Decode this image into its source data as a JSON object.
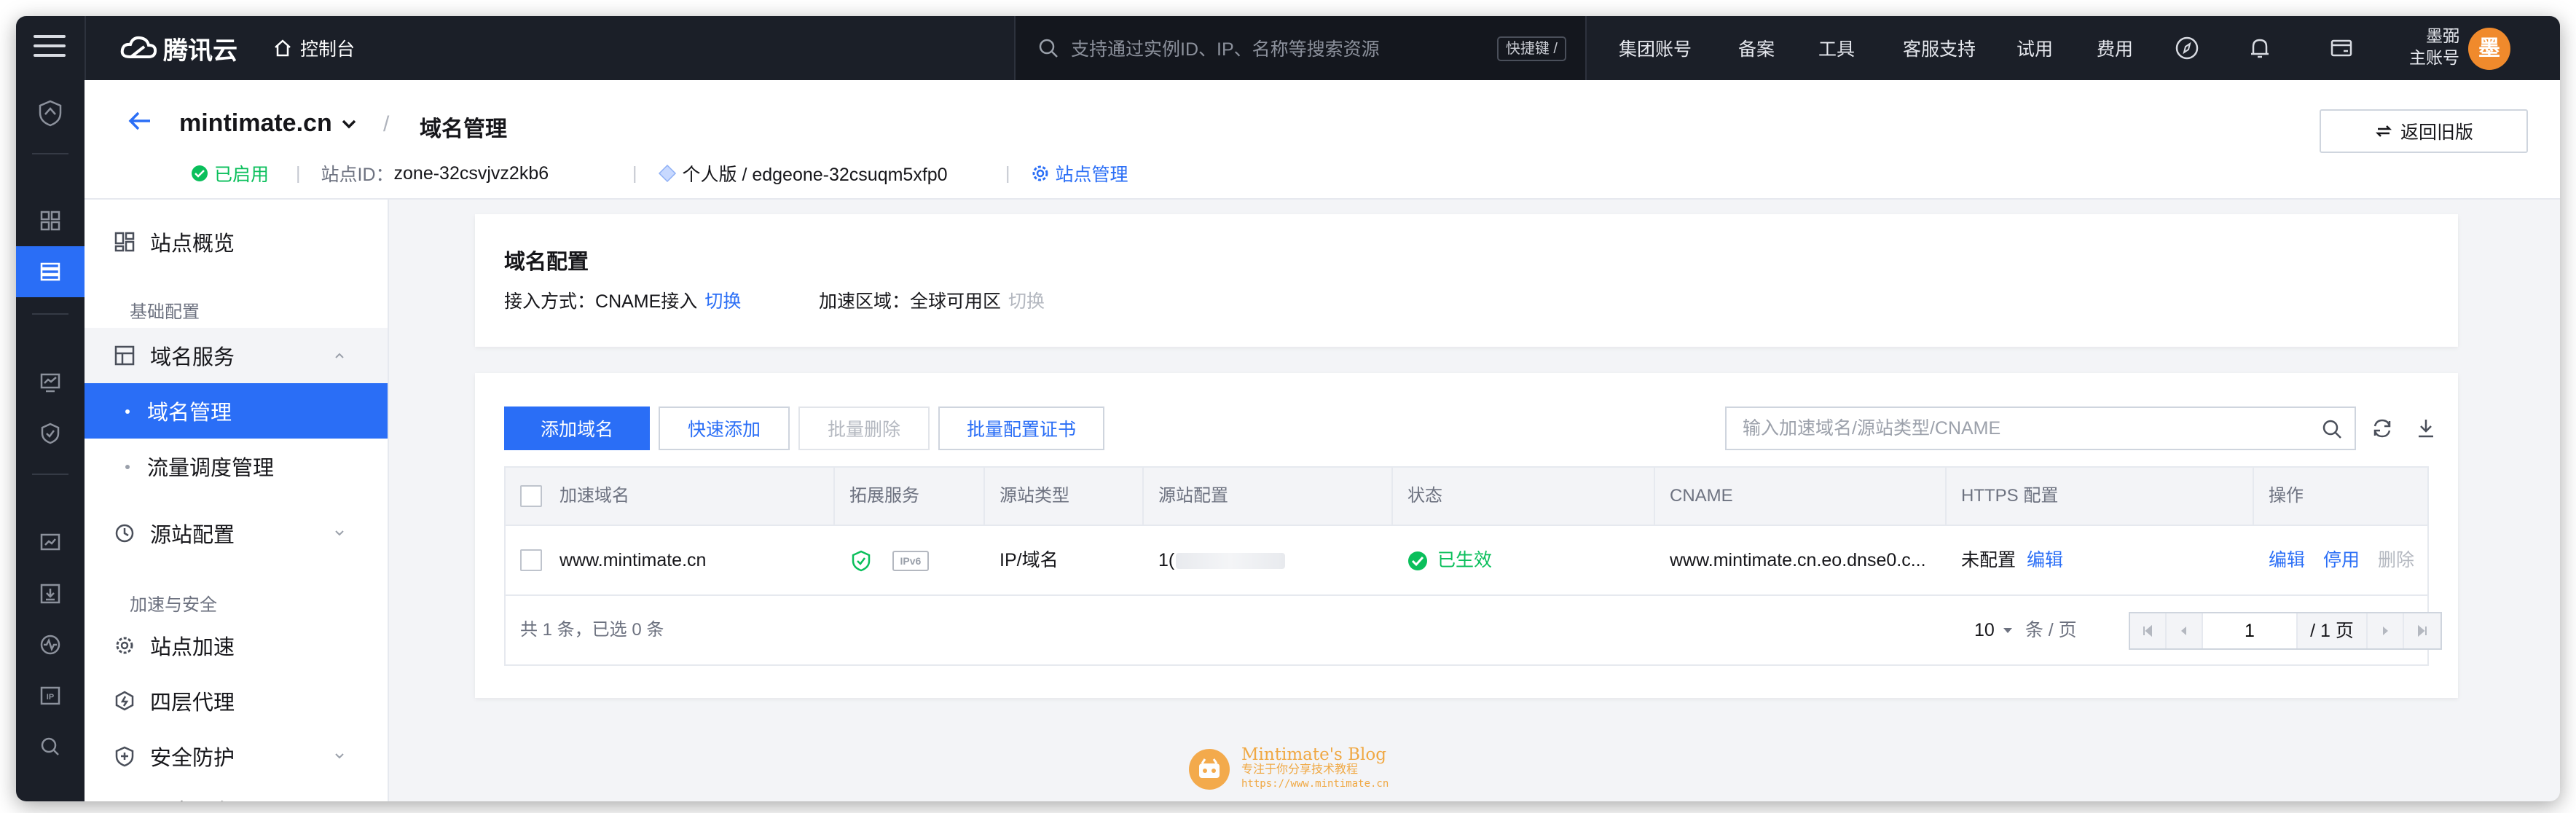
{
  "topbar": {
    "logo_text": "腾讯云",
    "console_label": "控制台",
    "search_placeholder": "支持通过实例ID、IP、名称等搜索资源",
    "shortcut_label": "快捷键 /",
    "nav": [
      "集团账号",
      "备案",
      "工具",
      "客服支持",
      "试用",
      "费用"
    ],
    "user_name_line1": "墨弼",
    "user_name_line2": "主账号",
    "avatar_char": "墨"
  },
  "site": {
    "name": "mintimate.cn",
    "page_title": "域名管理",
    "status": "已启用",
    "site_id_label": "站点ID：",
    "site_id": "zone-32csvjvz2kb6",
    "plan": "个人版 / edgeone-32csuqm5xfp0",
    "manage_link": "站点管理",
    "old_version_btn": "返回旧版"
  },
  "sidebar": {
    "overview": "站点概览",
    "section_basic": "基础配置",
    "domain_service": "域名服务",
    "domain_manage": "域名管理",
    "traffic_manage": "流量调度管理",
    "origin_config": "源站配置",
    "section_security": "加速与安全",
    "site_accel": "站点加速",
    "l4_proxy": "四层代理",
    "security": "安全防护",
    "log_service": "日志服务"
  },
  "domain_config": {
    "title": "域名配置",
    "access_label": "接入方式：",
    "access_value": "CNAME接入",
    "access_switch": "切换",
    "region_label": "加速区域：",
    "region_value": "全球可用区",
    "region_switch": "切换"
  },
  "toolbar": {
    "add_domain": "添加域名",
    "quick_add": "快速添加",
    "batch_delete": "批量删除",
    "batch_cert": "批量配置证书",
    "search_placeholder": "输入加速域名/源站类型/CNAME"
  },
  "table": {
    "headers": [
      "加速域名",
      "拓展服务",
      "源站类型",
      "源站配置",
      "状态",
      "CNAME",
      "HTTPS 配置",
      "操作"
    ],
    "rows": [
      {
        "domain": "www.mintimate.cn",
        "ipv6": "IPv6",
        "origin_type": "IP/域名",
        "origin_config": "1(",
        "status": "已生效",
        "cname": "www.mintimate.cn.eo.dnse0.c...",
        "https": "未配置",
        "https_edit": "编辑",
        "actions": [
          "编辑",
          "停用",
          "删除"
        ]
      }
    ]
  },
  "footer": {
    "summary": "共 1 条，已选 0 条",
    "page_size": "10",
    "page_size_unit": "条 / 页",
    "current_page": "1",
    "total_pages": "/ 1 页"
  },
  "watermark": {
    "line1": "Mintimate's Blog",
    "line2": "专注于你分享技术教程",
    "line3": "https://www.mintimate.cn"
  },
  "colors": {
    "accent": "#2a6ef6",
    "success": "#0abf5b",
    "topbar": "#1b1f28",
    "avatar": "#f08a2c"
  }
}
